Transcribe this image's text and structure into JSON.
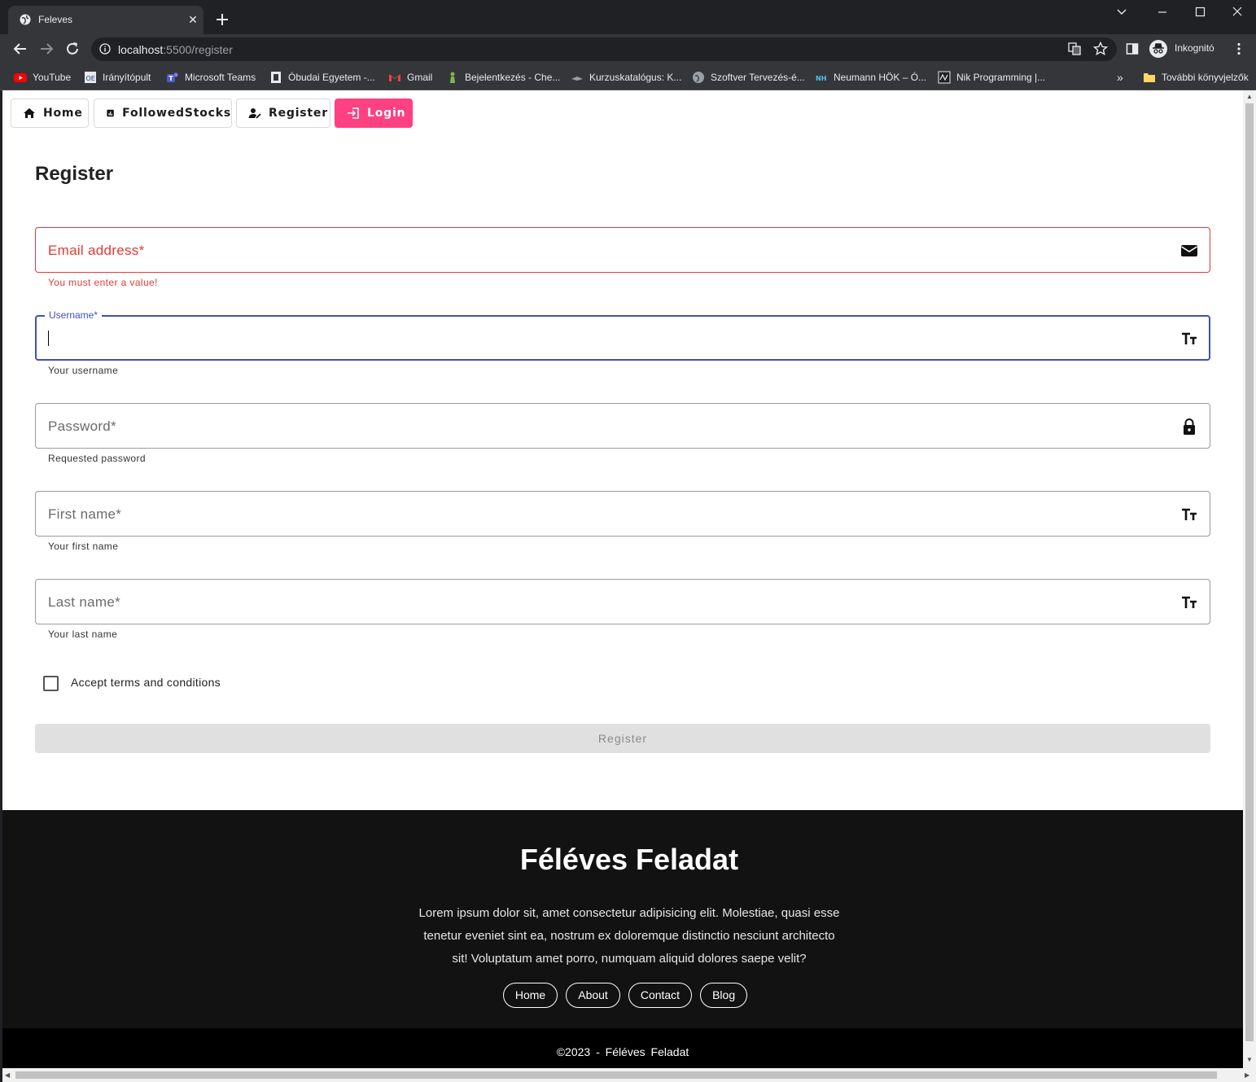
{
  "browser": {
    "tab_title": "Feleves",
    "url_host": "localhost",
    "url_path": ":5500/register",
    "profile_label": "Inkognitó",
    "bookmarks": [
      {
        "label": "YouTube",
        "icon": "youtube-icon"
      },
      {
        "label": "Irányítópult",
        "icon": "oe-icon"
      },
      {
        "label": "Microsoft Teams",
        "icon": "teams-icon"
      },
      {
        "label": "Óbudai Egyetem -...",
        "icon": "university-icon"
      },
      {
        "label": "Gmail",
        "icon": "gmail-icon"
      },
      {
        "label": "Bejelentkezés - Che...",
        "icon": "chess-icon"
      },
      {
        "label": "Kurzuskatalógus: K...",
        "icon": "course-icon"
      },
      {
        "label": "Szoftver Tervezés-é...",
        "icon": "globe-icon"
      },
      {
        "label": "Neumann HÖK – Ó...",
        "icon": "nh-icon"
      },
      {
        "label": "Nik Programming |...",
        "icon": "nik-icon"
      }
    ],
    "more_bookmarks": "További könyvjelzők",
    "overflow": "»"
  },
  "nav": {
    "home": "Home",
    "followed": "FollowedStocks",
    "register": "Register",
    "login": "Login",
    "login_color": "#ff4081"
  },
  "form": {
    "title": "Register",
    "email_label": "Email address*",
    "email_error": "You must enter a value!",
    "username_label": "Username*",
    "username_value": "",
    "username_hint": "Your username",
    "password_label": "Password*",
    "password_hint": "Requested password",
    "firstname_label": "First name*",
    "firstname_hint": "Your first name",
    "lastname_label": "Last name*",
    "lastname_hint": "Your last name",
    "terms_label": "Accept terms and conditions",
    "submit_label": "Register",
    "error_color": "#e53935",
    "focus_color": "#3f51b5"
  },
  "footer": {
    "title": "Féléves Feladat",
    "text": "Lorem ipsum dolor sit, amet consectetur adipisicing elit. Molestiae, quasi esse tenetur eveniet sint ea, nostrum ex doloremque distinctio nesciunt architecto sit! Voluptatum amet porro, numquam aliquid dolores saepe velit?",
    "links": [
      "Home",
      "About",
      "Contact",
      "Blog"
    ],
    "copyright": "©2023 - Féléves Feladat"
  }
}
